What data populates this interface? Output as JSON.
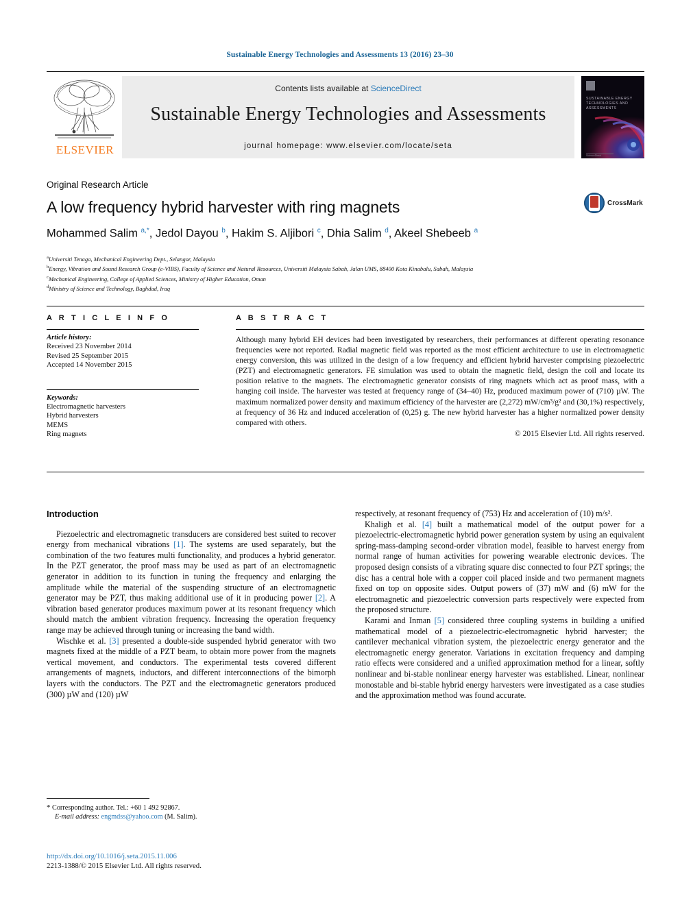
{
  "running_head": "Sustainable Energy Technologies and Assessments 13 (2016) 23–30",
  "masthead": {
    "contents_prefix": "Contents lists available at ",
    "sciencedirect": "ScienceDirect",
    "journal_name": "Sustainable Energy Technologies and Assessments",
    "homepage": "journal homepage: www.elsevier.com/locate/seta",
    "publisher": "ELSEVIER",
    "cover_title": "SUSTAINABLE ENERGY TECHNOLOGIES AND ASSESSMENTS",
    "cover_footer": "ScienceDirect"
  },
  "article": {
    "type": "Original Research Article",
    "title": "A low frequency hybrid harvester with ring magnets",
    "authors_html": "Mohammed Salim <sup>a,*</sup>, Jedol Dayou <sup>b</sup>, Hakim S. Aljibori <sup>c</sup>, Dhia Salim <sup>d</sup>, Akeel Shebeeb <sup>a</sup>",
    "crossmark_label": "CrossMark",
    "affiliations": [
      {
        "marker": "a",
        "text": "Universiti Tenaga, Mechanical Engineering Dept., Selangor, Malaysia"
      },
      {
        "marker": "b",
        "text": "Energy, Vibration and Sound Research Group (e-VIBS), Faculty of Science and Natural Resources, Universiti Malaysia Sabah, Jalan UMS, 88400 Kota Kinabalu, Sabah, Malaysia"
      },
      {
        "marker": "c",
        "text": "Mechanical Engineering, College of Applied Sciences, Ministry of Higher Education, Oman"
      },
      {
        "marker": "d",
        "text": "Ministry of Science and Technology, Baghdad, Iraq"
      }
    ]
  },
  "article_info": {
    "heading": "A R T I C L E   I N F O",
    "history_label": "Article history:",
    "history": [
      "Received 23 November 2014",
      "Revised 25 September 2015",
      "Accepted 14 November 2015"
    ],
    "keywords_label": "Keywords:",
    "keywords": [
      "Electromagnetic harvesters",
      "Hybrid harvesters",
      "MEMS",
      "Ring magnets"
    ]
  },
  "abstract": {
    "heading": "A B S T R A C T",
    "text": "Although many hybrid EH devices had been investigated by researchers, their performances at different operating resonance frequencies were not reported. Radial magnetic field was reported as the most efficient architecture to use in electromagnetic energy conversion, this was utilized in the design of a low frequency and efficient hybrid harvester comprising piezoelectric (PZT) and electromagnetic generators. FE simulation was used to obtain the magnetic field, design the coil and locate its position relative to the magnets. The electromagnetic generator consists of ring magnets which act as proof mass, with a hanging coil inside. The harvester was tested at frequency range of (34–40) Hz, produced maximum power of (710) µW. The maximum normalized power density and maximum efficiency of the harvester are (2,272) mW/cm³/g² and (30,1%) respectively, at frequency of 36 Hz and induced acceleration of (0,25) g. The new hybrid harvester has a higher normalized power density compared with others.",
    "rights": "© 2015 Elsevier Ltd. All rights reserved."
  },
  "body": {
    "intro_heading": "Introduction",
    "left_paragraphs": [
      "Piezoelectric and electromagnetic transducers are considered best suited to recover energy from mechanical vibrations [1]. The systems are used separately, but the combination of the two features multi functionality, and produces a hybrid generator. In the PZT generator, the proof mass may be used as part of an electromagnetic generator in addition to its function in tuning the frequency and enlarging the amplitude while the material of the suspending structure of an electromagnetic generator may be PZT, thus making additional use of it in producing power [2]. A vibration based generator produces maximum power at its resonant frequency which should match the ambient vibration frequency. Increasing the operation frequency range may be achieved through tuning or increasing the band width.",
      "Wischke et al. [3] presented a double-side suspended hybrid generator with two magnets fixed at the middle of a PZT beam, to obtain more power from the magnets vertical movement, and conductors. The experimental tests covered different arrangements of magnets, inductors, and different interconnections of the bimorph layers with the conductors. The PZT and the electromagnetic generators produced (300) µW and (120) µW"
    ],
    "right_paragraphs": [
      "respectively, at resonant frequency of (753) Hz and acceleration of (10) m/s².",
      "Khaligh et al. [4] built a mathematical model of the output power for a piezoelectric-electromagnetic hybrid power generation system by using an equivalent spring-mass-damping second-order vibration model, feasible to harvest energy from normal range of human activities for powering wearable electronic devices. The proposed design consists of a vibrating square disc connected to four PZT springs; the disc has a central hole with a copper coil placed inside and two permanent magnets fixed on top on opposite sides. Output powers of (37) mW and (6) mW for the electromagnetic and piezoelectric conversion parts respectively were expected from the proposed structure.",
      "Karami and Inman [5] considered three coupling systems in building a unified mathematical model of a piezoelectric-electromagnetic hybrid harvester; the cantilever mechanical vibration system, the piezoelectric energy generator and the electromagnetic energy generator. Variations in excitation frequency and damping ratio effects were considered and a unified approximation method for a linear, softly nonlinear and bi-stable nonlinear energy harvester was established. Linear, nonlinear monostable and bi-stable hybrid energy harvesters were investigated as a case studies and the approximation method was found accurate."
    ],
    "references_inline": [
      "[1]",
      "[2]",
      "[3]",
      "[4]",
      "[5]"
    ]
  },
  "footer": {
    "corresponding_star": "*",
    "corresponding_text": "Corresponding author. Tel.: +60 1 492 92867.",
    "email_label": "E-mail address:",
    "email": "engmdss@yahoo.com",
    "email_suffix": "(M. Salim).",
    "doi": "http://dx.doi.org/10.1016/j.seta.2015.11.006",
    "issn_line": "2213-1388/© 2015 Elsevier Ltd. All rights reserved."
  },
  "colors": {
    "link": "#2b7bb9",
    "header_blue": "#1a6496",
    "elsevier_orange": "#f47b20",
    "masthead_gray": "#ececec"
  }
}
